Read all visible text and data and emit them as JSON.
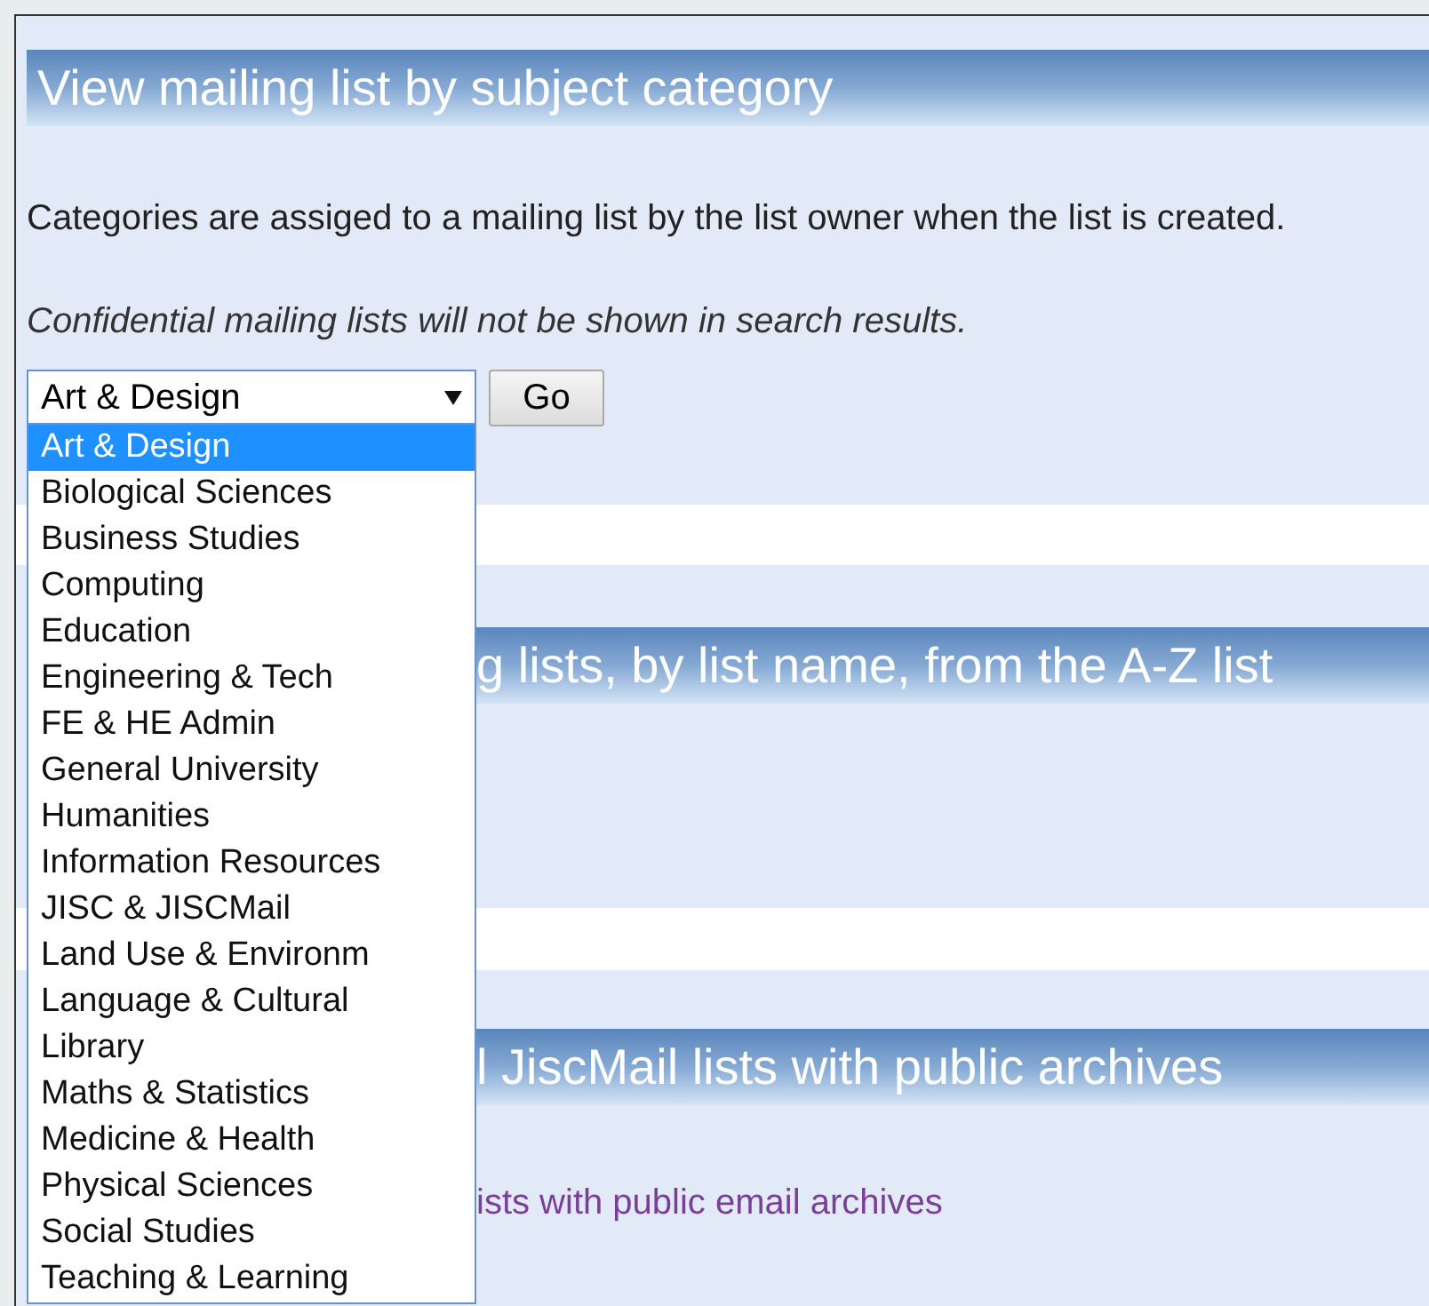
{
  "section_1": {
    "heading": "View mailing list by subject category",
    "description": "Categories are assiged to a mailing list by the list owner when the list is created.",
    "note": "Confidential mailing lists will not be shown in search results.",
    "select": {
      "value": "Art & Design",
      "expanded": true
    },
    "go_button": "Go"
  },
  "dropdown_options": [
    {
      "label": "Art & Design",
      "selected": true
    },
    {
      "label": "Biological Sciences",
      "selected": false
    },
    {
      "label": "Business Studies",
      "selected": false
    },
    {
      "label": "Computing",
      "selected": false
    },
    {
      "label": "Education",
      "selected": false
    },
    {
      "label": "Engineering & Tech",
      "selected": false
    },
    {
      "label": "FE & HE Admin",
      "selected": false
    },
    {
      "label": "General University",
      "selected": false
    },
    {
      "label": "Humanities",
      "selected": false
    },
    {
      "label": "Information Resources",
      "selected": false
    },
    {
      "label": "JISC & JISCMail",
      "selected": false
    },
    {
      "label": "Land Use & Environm",
      "selected": false
    },
    {
      "label": "Language & Cultural",
      "selected": false
    },
    {
      "label": "Library",
      "selected": false
    },
    {
      "label": "Maths & Statistics",
      "selected": false
    },
    {
      "label": "Medicine & Health",
      "selected": false
    },
    {
      "label": "Physical Sciences",
      "selected": false
    },
    {
      "label": "Social Studies",
      "selected": false
    },
    {
      "label": "Teaching & Learning",
      "selected": false
    }
  ],
  "section_2": {
    "heading": "g lists, by list name, from the A-Z list"
  },
  "section_3": {
    "heading": "l JiscMail lists with public archives",
    "link": "ists with public email archives"
  }
}
